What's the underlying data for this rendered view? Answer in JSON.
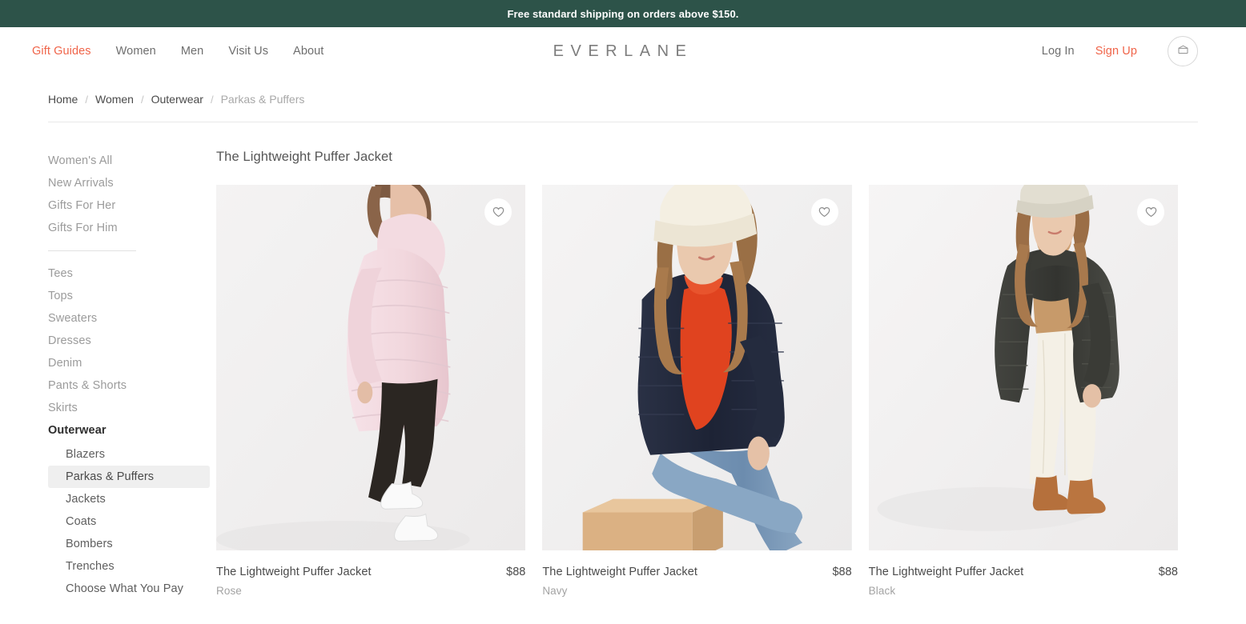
{
  "promo": {
    "message": "Free standard shipping on orders above $150."
  },
  "header": {
    "brand": "EVERLANE",
    "nav_left": [
      {
        "label": "Gift Guides",
        "accent": true
      },
      {
        "label": "Women",
        "accent": false
      },
      {
        "label": "Men",
        "accent": false
      },
      {
        "label": "Visit Us",
        "accent": false
      },
      {
        "label": "About",
        "accent": false
      }
    ],
    "nav_right": [
      {
        "label": "Log In",
        "accent": false
      },
      {
        "label": "Sign Up",
        "accent": true
      }
    ],
    "cart_icon": "shopping-bag-icon"
  },
  "breadcrumb": {
    "items": [
      {
        "label": "Home",
        "current": false
      },
      {
        "label": "Women",
        "current": false
      },
      {
        "label": "Outerwear",
        "current": false
      },
      {
        "label": "Parkas & Puffers",
        "current": true
      }
    ],
    "separator": "/"
  },
  "sidebar": {
    "group_one": [
      {
        "label": "Women's All"
      },
      {
        "label": "New Arrivals"
      },
      {
        "label": "Gifts For Her"
      },
      {
        "label": "Gifts For Him"
      }
    ],
    "group_two": [
      {
        "label": "Tees",
        "active": false
      },
      {
        "label": "Tops",
        "active": false
      },
      {
        "label": "Sweaters",
        "active": false
      },
      {
        "label": "Dresses",
        "active": false
      },
      {
        "label": "Denim",
        "active": false
      },
      {
        "label": "Pants & Shorts",
        "active": false
      },
      {
        "label": "Skirts",
        "active": false
      },
      {
        "label": "Outerwear",
        "active": true
      }
    ],
    "sub_items": [
      {
        "label": "Blazers",
        "selected": false
      },
      {
        "label": "Parkas & Puffers",
        "selected": true
      },
      {
        "label": "Jackets",
        "selected": false
      },
      {
        "label": "Coats",
        "selected": false
      },
      {
        "label": "Bombers",
        "selected": false
      },
      {
        "label": "Trenches",
        "selected": false
      },
      {
        "label": "Choose What You Pay",
        "selected": false
      }
    ]
  },
  "main": {
    "collection_title": "The Lightweight Puffer Jacket",
    "products": [
      {
        "name": "The Lightweight Puffer Jacket",
        "price": "$88",
        "color": "Rose",
        "wishlist_icon": "heart-icon"
      },
      {
        "name": "The Lightweight Puffer Jacket",
        "price": "$88",
        "color": "Navy",
        "wishlist_icon": "heart-icon"
      },
      {
        "name": "The Lightweight Puffer Jacket",
        "price": "$88",
        "color": "Black",
        "wishlist_icon": "heart-icon"
      }
    ]
  },
  "colors": {
    "banner_green": "#2d5349",
    "accent_coral": "#f06449",
    "image_background": "#f1f1f1",
    "selected_background": "#efefef"
  }
}
